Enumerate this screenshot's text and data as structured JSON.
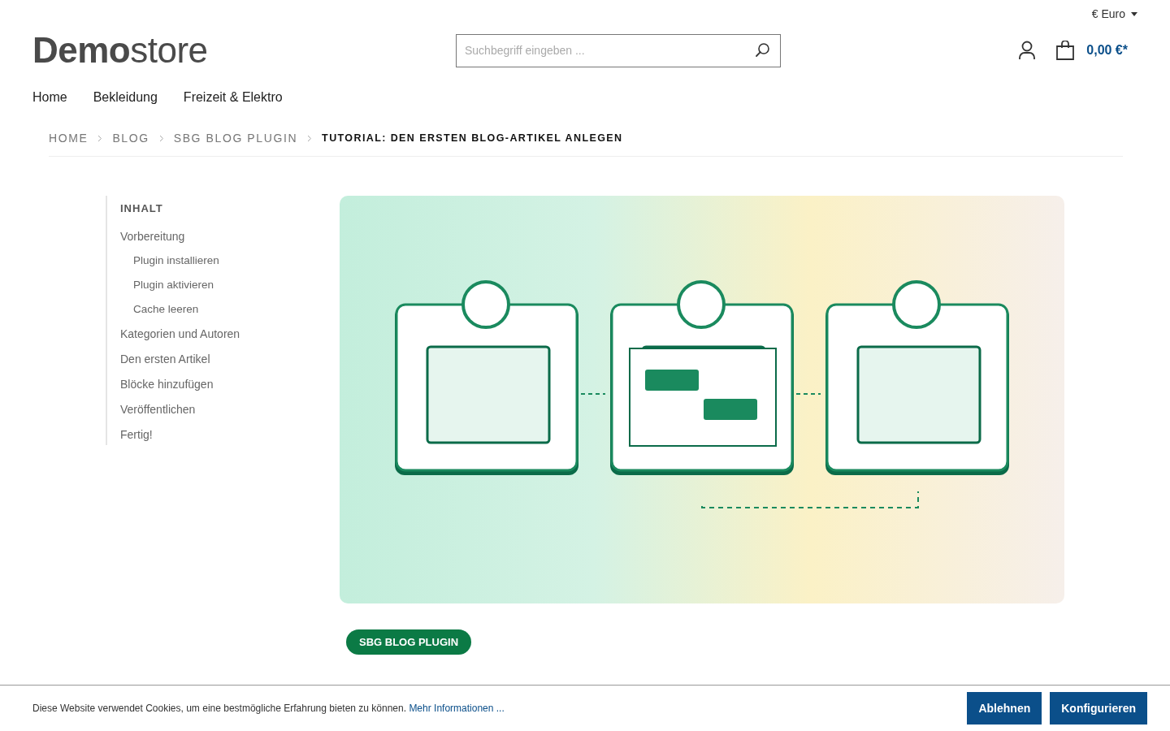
{
  "header": {
    "currency": "€ Euro",
    "logo": {
      "bold": "Demo",
      "light": "store"
    },
    "search": {
      "placeholder": "Suchbegriff eingeben ..."
    },
    "cart_total": "0,00 €*"
  },
  "nav": [
    "Home",
    "Bekleidung",
    "Freizeit & Elektro"
  ],
  "breadcrumb": [
    {
      "label": "HOME",
      "current": false
    },
    {
      "label": "BLOG",
      "current": false
    },
    {
      "label": "SBG BLOG PLUGIN",
      "current": false
    },
    {
      "label": "TUTORIAL: DEN ERSTEN BLOG-ARTIKEL ANLEGEN",
      "current": true
    }
  ],
  "toc": {
    "title": "INHALT",
    "items": [
      {
        "label": "Vorbereitung",
        "children": [
          {
            "label": "Plugin installieren"
          },
          {
            "label": "Plugin aktivieren"
          },
          {
            "label": "Cache leeren"
          }
        ]
      },
      {
        "label": "Kategorien und Autoren"
      },
      {
        "label": "Den ersten Artikel"
      },
      {
        "label": "Blöcke hinzufügen"
      },
      {
        "label": "Veröffentlichen"
      },
      {
        "label": "Fertig!"
      }
    ]
  },
  "article": {
    "category": "SBG BLOG PLUGIN"
  },
  "cookie_bar": {
    "text": "Diese Website verwendet Cookies, um eine bestmögliche Erfahrung bieten zu können.",
    "link": "Mehr Informationen ...",
    "buttons": [
      "Ablehnen",
      "Konfigurieren"
    ]
  }
}
